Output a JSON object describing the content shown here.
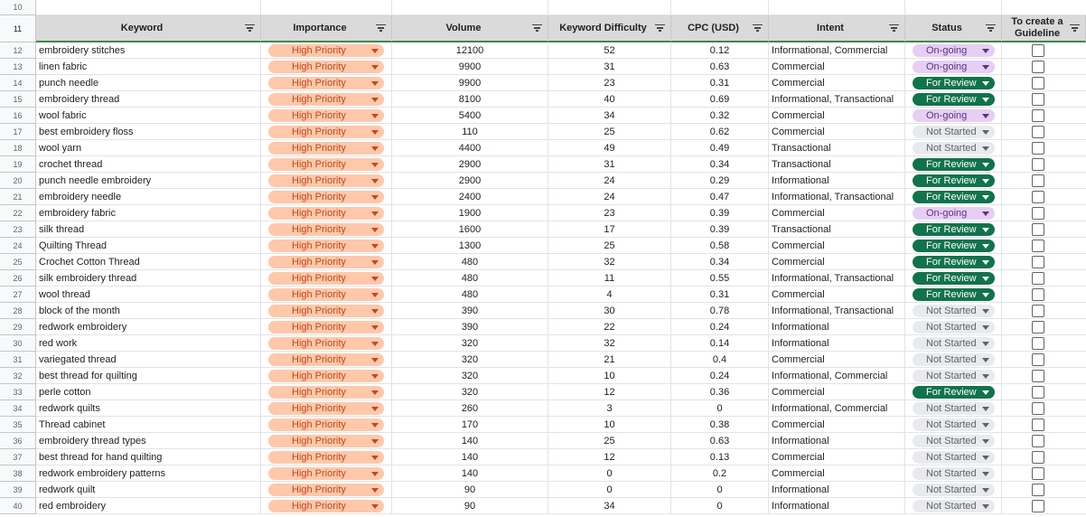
{
  "header_row_number": "11",
  "empty_row_number": "10",
  "columns": {
    "keyword": "Keyword",
    "importance": "Importance",
    "volume": "Volume",
    "difficulty": "Keyword Difficulty",
    "cpc": "CPC (USD)",
    "intent": "Intent",
    "status": "Status",
    "guideline": "To create a Guideline"
  },
  "colors": {
    "importance_chip": "#ffc8aa",
    "status_ongoing": "#e6cff2",
    "status_review": "#11734b",
    "status_not_started": "#e8eaed",
    "header_bg": "#dadada",
    "header_border": "#3c8a4a"
  },
  "icons": {
    "filter": "filter-icon",
    "dropdown": "dropdown-arrow-icon",
    "checkbox": "checkbox-icon"
  },
  "rows": [
    {
      "n": "12",
      "keyword": "embroidery stitches",
      "importance": "High Priority",
      "volume": "12100",
      "kd": "52",
      "cpc": "0.12",
      "intent": "Informational, Commercial",
      "status": "On-going",
      "status_type": "ongoing",
      "checked": false
    },
    {
      "n": "13",
      "keyword": "linen fabric",
      "importance": "High Priority",
      "volume": "9900",
      "kd": "31",
      "cpc": "0.63",
      "intent": "Commercial",
      "status": "On-going",
      "status_type": "ongoing",
      "checked": false
    },
    {
      "n": "14",
      "keyword": "punch needle",
      "importance": "High Priority",
      "volume": "9900",
      "kd": "23",
      "cpc": "0.31",
      "intent": "Commercial",
      "status": "For Review",
      "status_type": "review",
      "checked": false
    },
    {
      "n": "15",
      "keyword": "embroidery thread",
      "importance": "High Priority",
      "volume": "8100",
      "kd": "40",
      "cpc": "0.69",
      "intent": "Informational, Transactional",
      "status": "For Review",
      "status_type": "review",
      "checked": false
    },
    {
      "n": "16",
      "keyword": "wool fabric",
      "importance": "High Priority",
      "volume": "5400",
      "kd": "34",
      "cpc": "0.32",
      "intent": "Commercial",
      "status": "On-going",
      "status_type": "ongoing",
      "checked": false
    },
    {
      "n": "17",
      "keyword": "best embroidery floss",
      "importance": "High Priority",
      "volume": "110",
      "kd": "25",
      "cpc": "0.62",
      "intent": "Commercial",
      "status": "Not Started",
      "status_type": "notstarted",
      "checked": false
    },
    {
      "n": "18",
      "keyword": "wool yarn",
      "importance": "High Priority",
      "volume": "4400",
      "kd": "49",
      "cpc": "0.49",
      "intent": "Transactional",
      "status": "Not Started",
      "status_type": "notstarted",
      "checked": false
    },
    {
      "n": "19",
      "keyword": "crochet thread",
      "importance": "High Priority",
      "volume": "2900",
      "kd": "31",
      "cpc": "0.34",
      "intent": "Transactional",
      "status": "For Review",
      "status_type": "review",
      "checked": false
    },
    {
      "n": "20",
      "keyword": "punch needle embroidery",
      "importance": "High Priority",
      "volume": "2900",
      "kd": "24",
      "cpc": "0.29",
      "intent": "Informational",
      "status": "For Review",
      "status_type": "review",
      "checked": false
    },
    {
      "n": "21",
      "keyword": "embroidery needle",
      "importance": "High Priority",
      "volume": "2400",
      "kd": "24",
      "cpc": "0.47",
      "intent": "Informational, Transactional",
      "status": "For Review",
      "status_type": "review",
      "checked": false
    },
    {
      "n": "22",
      "keyword": "embroidery fabric",
      "importance": "High Priority",
      "volume": "1900",
      "kd": "23",
      "cpc": "0.39",
      "intent": "Commercial",
      "status": "On-going",
      "status_type": "ongoing",
      "checked": false
    },
    {
      "n": "23",
      "keyword": "silk thread",
      "importance": "High Priority",
      "volume": "1600",
      "kd": "17",
      "cpc": "0.39",
      "intent": "Transactional",
      "status": "For Review",
      "status_type": "review",
      "checked": false
    },
    {
      "n": "24",
      "keyword": "Quilting Thread",
      "importance": "High Priority",
      "volume": "1300",
      "kd": "25",
      "cpc": "0.58",
      "intent": "Commercial",
      "status": "For Review",
      "status_type": "review",
      "checked": false
    },
    {
      "n": "25",
      "keyword": "Crochet Cotton Thread",
      "importance": "High Priority",
      "volume": "480",
      "kd": "32",
      "cpc": "0.34",
      "intent": "Commercial",
      "status": "For Review",
      "status_type": "review",
      "checked": false
    },
    {
      "n": "26",
      "keyword": "silk embroidery thread",
      "importance": "High Priority",
      "volume": "480",
      "kd": "11",
      "cpc": "0.55",
      "intent": "Informational, Transactional",
      "status": "For Review",
      "status_type": "review",
      "checked": false
    },
    {
      "n": "27",
      "keyword": "wool thread",
      "importance": "High Priority",
      "volume": "480",
      "kd": "4",
      "cpc": "0.31",
      "intent": "Commercial",
      "status": "For Review",
      "status_type": "review",
      "checked": false
    },
    {
      "n": "28",
      "keyword": "block of the month",
      "importance": "High Priority",
      "volume": "390",
      "kd": "30",
      "cpc": "0.78",
      "intent": "Informational, Transactional",
      "status": "Not Started",
      "status_type": "notstarted",
      "checked": false
    },
    {
      "n": "29",
      "keyword": "redwork embroidery",
      "importance": "High Priority",
      "volume": "390",
      "kd": "22",
      "cpc": "0.24",
      "intent": "Informational",
      "status": "Not Started",
      "status_type": "notstarted",
      "checked": false
    },
    {
      "n": "30",
      "keyword": "red work",
      "importance": "High Priority",
      "volume": "320",
      "kd": "32",
      "cpc": "0.14",
      "intent": "Informational",
      "status": "Not Started",
      "status_type": "notstarted",
      "checked": false
    },
    {
      "n": "31",
      "keyword": "variegated thread",
      "importance": "High Priority",
      "volume": "320",
      "kd": "21",
      "cpc": "0.4",
      "intent": "Commercial",
      "status": "Not Started",
      "status_type": "notstarted",
      "checked": false
    },
    {
      "n": "32",
      "keyword": "best thread for quilting",
      "importance": "High Priority",
      "volume": "320",
      "kd": "10",
      "cpc": "0.24",
      "intent": "Informational, Commercial",
      "status": "Not Started",
      "status_type": "notstarted",
      "checked": false
    },
    {
      "n": "33",
      "keyword": "perle cotton",
      "importance": "High Priority",
      "volume": "320",
      "kd": "12",
      "cpc": "0.36",
      "intent": "Commercial",
      "status": "For Review",
      "status_type": "review",
      "checked": false
    },
    {
      "n": "34",
      "keyword": "redwork quilts",
      "importance": "High Priority",
      "volume": "260",
      "kd": "3",
      "cpc": "0",
      "intent": "Informational, Commercial",
      "status": "Not Started",
      "status_type": "notstarted",
      "checked": false
    },
    {
      "n": "35",
      "keyword": "Thread cabinet",
      "importance": "High Priority",
      "volume": "170",
      "kd": "10",
      "cpc": "0.38",
      "intent": "Commercial",
      "status": "Not Started",
      "status_type": "notstarted",
      "checked": false
    },
    {
      "n": "36",
      "keyword": "embroidery thread types",
      "importance": "High Priority",
      "volume": "140",
      "kd": "25",
      "cpc": "0.63",
      "intent": "Informational",
      "status": "Not Started",
      "status_type": "notstarted",
      "checked": false
    },
    {
      "n": "37",
      "keyword": "best thread for hand quilting",
      "importance": "High Priority",
      "volume": "140",
      "kd": "12",
      "cpc": "0.13",
      "intent": "Commercial",
      "status": "Not Started",
      "status_type": "notstarted",
      "checked": false
    },
    {
      "n": "38",
      "keyword": "redwork embroidery patterns",
      "importance": "High Priority",
      "volume": "140",
      "kd": "0",
      "cpc": "0.2",
      "intent": "Commercial",
      "status": "Not Started",
      "status_type": "notstarted",
      "checked": false
    },
    {
      "n": "39",
      "keyword": "redwork quilt",
      "importance": "High Priority",
      "volume": "90",
      "kd": "0",
      "cpc": "0",
      "intent": "Informational",
      "status": "Not Started",
      "status_type": "notstarted",
      "checked": false
    },
    {
      "n": "40",
      "keyword": "red embroidery",
      "importance": "High Priority",
      "volume": "90",
      "kd": "34",
      "cpc": "0",
      "intent": "Informational",
      "status": "Not Started",
      "status_type": "notstarted",
      "checked": false
    }
  ]
}
